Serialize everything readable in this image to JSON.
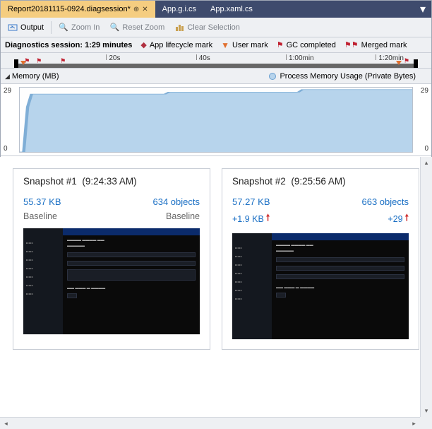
{
  "tabs": {
    "active": "Report20181115-0924.diagsession*",
    "others": [
      "App.g.i.cs",
      "App.xaml.cs"
    ]
  },
  "toolbar": {
    "output": "Output",
    "zoom_in": "Zoom In",
    "reset_zoom": "Reset Zoom",
    "clear_sel": "Clear Selection"
  },
  "session": {
    "label": "Diagnostics session:",
    "duration": "1:29 minutes",
    "legend_life": "App lifecycle mark",
    "legend_user": "User mark",
    "legend_gc": "GC completed",
    "legend_merge": "Merged mark"
  },
  "ruler": {
    "ticks": [
      "20s",
      "40s",
      "1:00min",
      "1:20min"
    ]
  },
  "memory": {
    "title": "Memory (MB)",
    "legend": "Process Memory Usage (Private Bytes)",
    "ymax": "29",
    "ymin": "0"
  },
  "chart_data": {
    "type": "area",
    "title": "Memory (MB)",
    "xlabel": "time",
    "ylabel": "MB",
    "ylim": [
      0,
      29
    ],
    "series": [
      {
        "name": "Process Memory Usage (Private Bytes)",
        "x_seconds": [
          0,
          2,
          3,
          33,
          34,
          63,
          64,
          89
        ],
        "values": [
          0,
          20,
          26,
          26,
          27,
          27,
          28,
          28
        ]
      }
    ]
  },
  "snapshots": [
    {
      "title": "Snapshot #1",
      "time": "(9:24:33 AM)",
      "size": "55.37 KB",
      "objects": "634 objects",
      "sub_left": "Baseline",
      "sub_right": "Baseline",
      "diff_left": "",
      "diff_right": ""
    },
    {
      "title": "Snapshot #2",
      "time": "(9:25:56 AM)",
      "size": "57.27 KB",
      "objects": "663 objects",
      "sub_left": "",
      "sub_right": "",
      "diff_left": "+1.9 KB",
      "diff_right": "+29"
    }
  ]
}
